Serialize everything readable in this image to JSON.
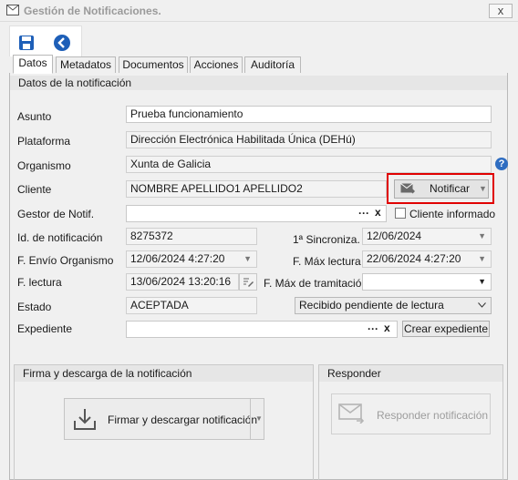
{
  "window": {
    "title": "Gestión de Notificaciones.",
    "close_label": "x"
  },
  "toolbar": {
    "save": "save-icon",
    "back": "back-icon"
  },
  "tabs": [
    "Datos",
    "Metadatos",
    "Documentos",
    "Acciones",
    "Auditoría"
  ],
  "section_title": "Datos de la notificación",
  "labels": {
    "asunto": "Asunto",
    "plataforma": "Plataforma",
    "organismo": "Organismo",
    "cliente": "Cliente",
    "gestor": "Gestor de Notif.",
    "id": "Id. de notificación",
    "sincroniza": "1ª Sincroniza.",
    "envio": "F. Envío Organismo",
    "max_lectura": "F. Máx lectura",
    "lectura": "F. lectura",
    "max_tramitacion": "F. Máx de tramitación",
    "estado": "Estado",
    "expediente": "Expediente"
  },
  "values": {
    "asunto": "Prueba funcionamiento",
    "plataforma": "Dirección Electrónica Habilitada Única (DEHú)",
    "organismo": "Xunta de Galicia",
    "cliente": "NOMBRE APELLIDO1 APELLIDO2",
    "gestor": "",
    "id": "8275372",
    "sincroniza": "12/06/2024",
    "envio": "12/06/2024 4:27:20",
    "max_lectura": "22/06/2024 4:27:20",
    "lectura": "13/06/2024 13:20:16",
    "max_tramitacion": "",
    "estado": "ACEPTADA",
    "estado_detalle": "Recibido pendiente de lectura",
    "expediente": ""
  },
  "buttons": {
    "notificar": "Notificar",
    "dots": "···",
    "clear": "x",
    "cliente_informado": "Cliente informado",
    "crear_expediente": "Crear expediente",
    "firmar": "Firmar y descargar notificación",
    "responder": "Responder notificación",
    "help": "?"
  },
  "groups": {
    "firma": "Firma y descarga de la notificación",
    "responder": "Responder"
  },
  "colors": {
    "highlight": "#e00000",
    "accent": "#1e5fb8"
  }
}
